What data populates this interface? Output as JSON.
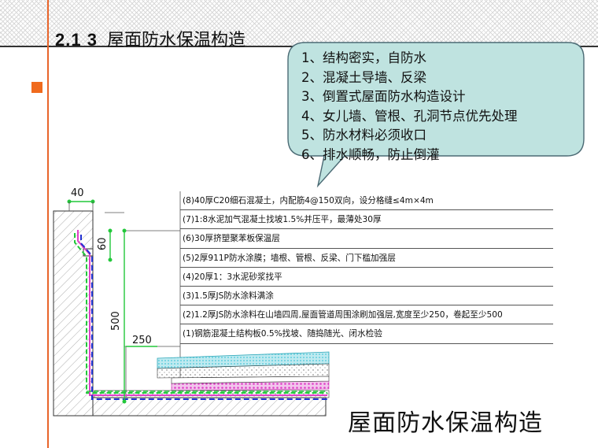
{
  "slide": {
    "section_number": "2.1 3",
    "section_title": "屋面防水保温构造",
    "caption": "屋面防水保温构造"
  },
  "callout": {
    "points": [
      "1、结构密实，自防水",
      "2、混凝土导墙、反梁",
      "3、倒置式屋面防水构造设计",
      "4、女儿墙、管根、孔洞节点优先处理",
      "5、防水材料必须收口",
      "6、排水顺畅，防止倒灌"
    ]
  },
  "layers": [
    "(8)40厚C20细石混凝土，内配筋4@150双向，设分格缝≤4m×4m",
    "(7)1:8水泥加气混凝土找坡1.5%并压平，最薄处30厚",
    "(6)30厚挤塑聚苯板保温层",
    "(5)2厚911P防水涂膜；墙根、管根、反梁、门下槛加强层",
    "(4)20厚1：3水泥砂浆找平",
    "(3)1.5厚JS防水涂料满涂",
    "(2)1.2厚JS防水涂料在山墙四周,屋面管道周围涂刷加强层,宽度至少250，卷起至少500",
    "(1)钢筋混凝土结构板0.5%找坡、随捣随光、闭水检验"
  ],
  "dimensions": {
    "top_width": "40",
    "upturn_height": "60",
    "rise_height": "500",
    "horizontal_length": "250"
  },
  "colors": {
    "accent_orange": "#f06a1d",
    "bubble_fill": "#bfe3e0",
    "waterproof_green": "#22c83a",
    "waterproof_blue": "#1f2fd0",
    "insulation_magenta": "#e040c8",
    "screed_cyan": "#49c7d8"
  }
}
